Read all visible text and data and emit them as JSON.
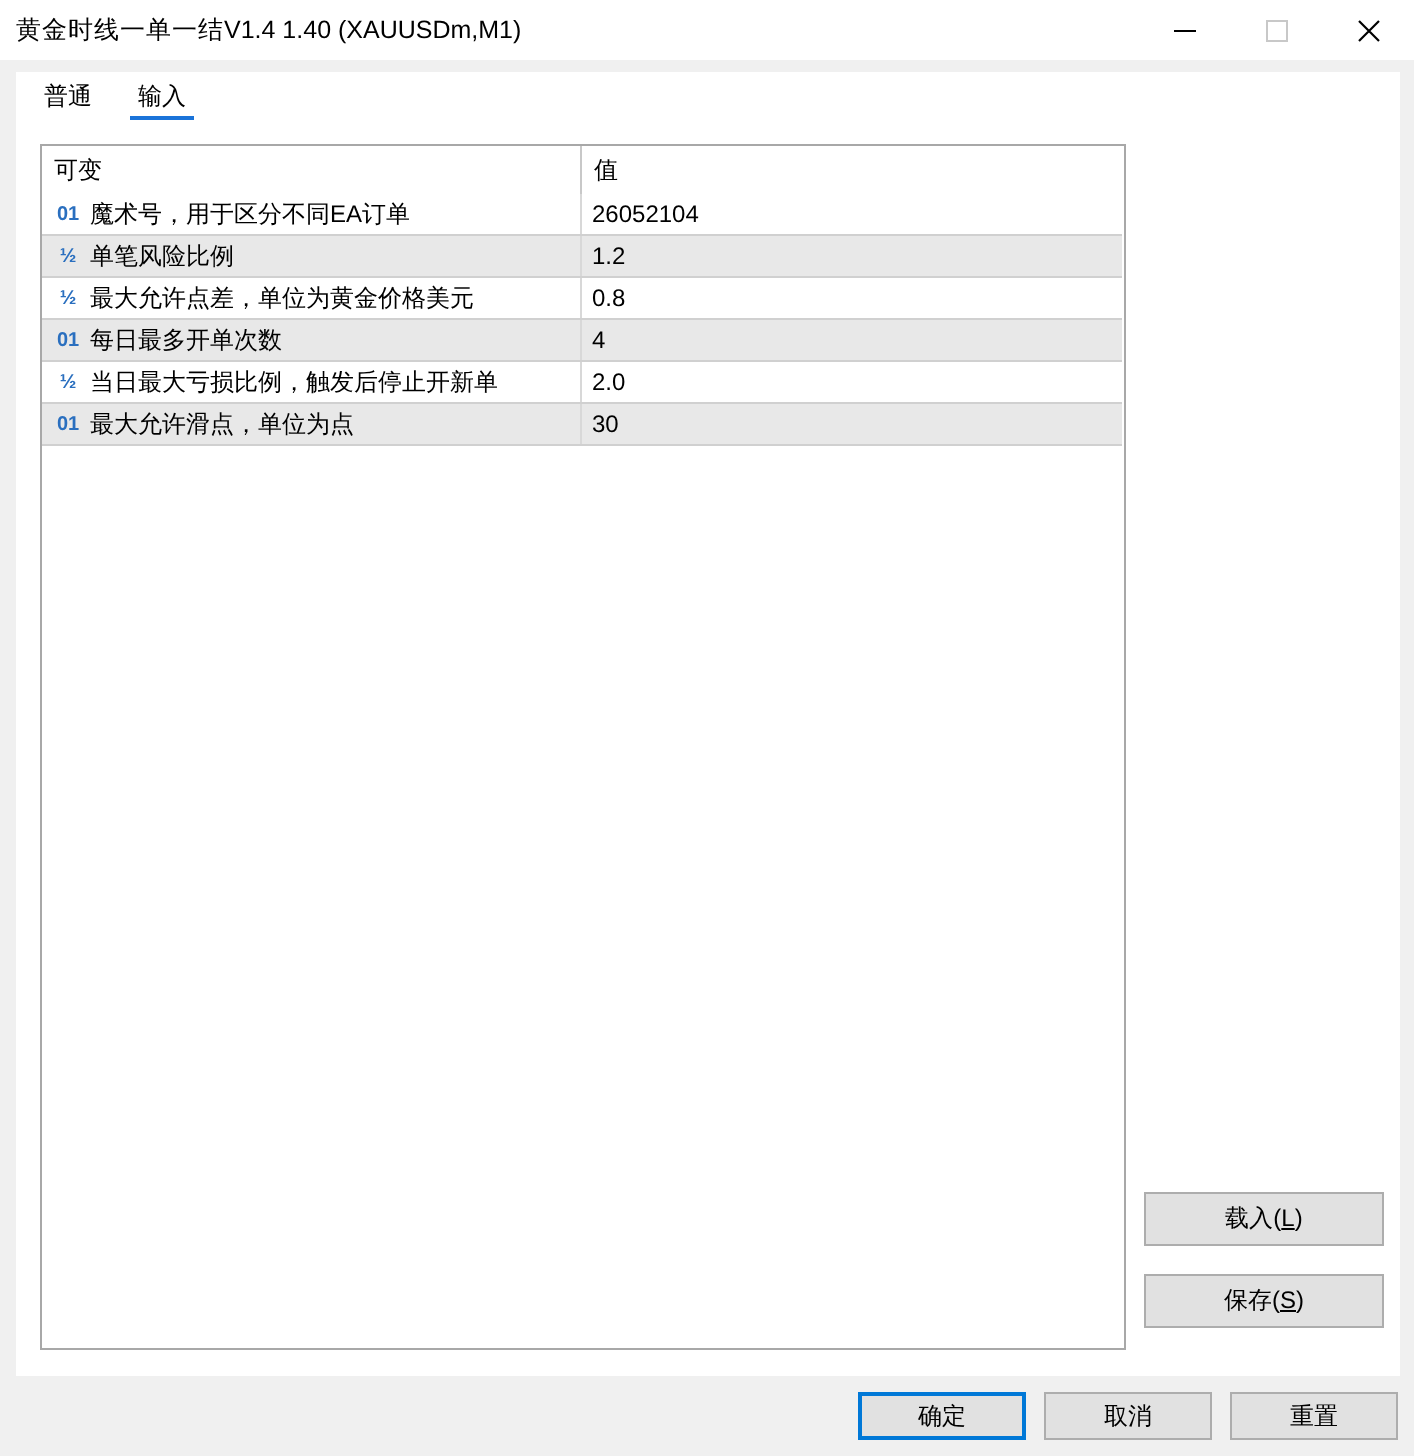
{
  "window": {
    "title": "黄金时线一单一结V1.4 1.40 (XAUUSDm,M1)",
    "controls": [
      {
        "kind": "minimize",
        "disabled": false
      },
      {
        "kind": "maximize",
        "disabled": true
      },
      {
        "kind": "close",
        "disabled": false
      }
    ]
  },
  "tabs": [
    {
      "label": "普通",
      "selected": false
    },
    {
      "label": "输入",
      "selected": true
    }
  ],
  "table": {
    "columns": [
      "可变",
      "值"
    ],
    "rows": [
      {
        "type_icon": "01",
        "name": "魔术号，用于区分不同EA订单",
        "value": "26052104"
      },
      {
        "type_icon": "½",
        "name": "单笔风险比例",
        "value": "1.2"
      },
      {
        "type_icon": "½",
        "name": "最大允许点差，单位为黄金价格美元",
        "value": "0.8"
      },
      {
        "type_icon": "01",
        "name": "每日最多开单次数",
        "value": "4"
      },
      {
        "type_icon": "½",
        "name": "当日最大亏损比例，触发后停止开新单",
        "value": "2.0"
      },
      {
        "type_icon": "01",
        "name": "最大允许滑点，单位为点",
        "value": "30"
      }
    ]
  },
  "side_buttons": [
    {
      "label": "载入(",
      "access_key": "L",
      "label_end": ")"
    },
    {
      "label": "保存(",
      "access_key": "S",
      "label_end": ")"
    }
  ],
  "buttons": [
    {
      "label": "确定",
      "default": true
    },
    {
      "label": "取消",
      "default": false
    },
    {
      "label": "重置",
      "default": false
    }
  ]
}
